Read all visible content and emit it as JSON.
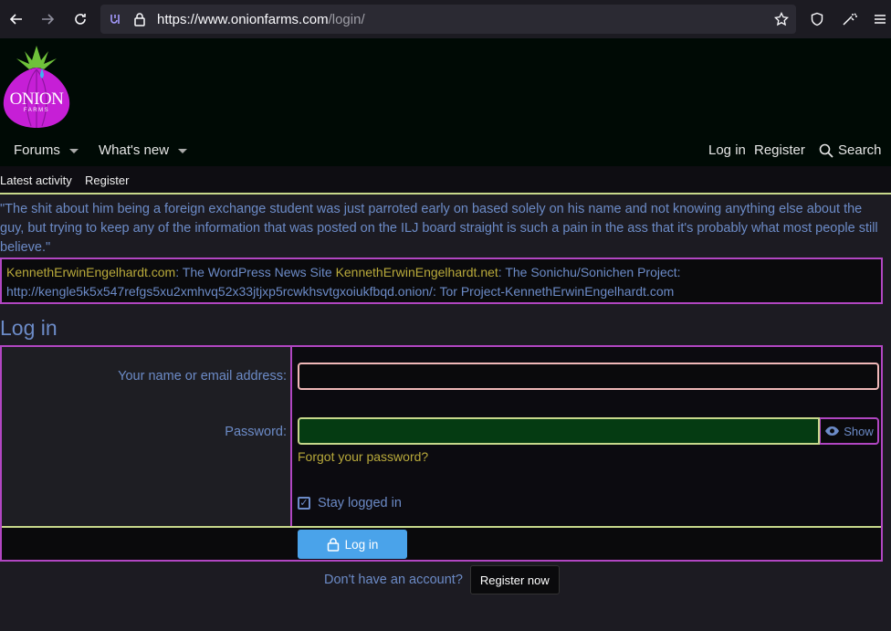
{
  "browser": {
    "url_main": "https://www.onionfarms.com",
    "url_path": "/login/"
  },
  "logo": {
    "line1": "ONION",
    "line2": "FARMS"
  },
  "nav": {
    "forums": "Forums",
    "whats_new": "What's new",
    "login": "Log in",
    "register": "Register",
    "search": "Search"
  },
  "subnav": {
    "latest": "Latest activity",
    "register": "Register"
  },
  "quote": "\"The shit about him being a foreign exchange student was just parroted early on based solely on his name and not knowing anything else about the guy, but trying to keep any of the information that was posted on the ILJ board straight is such a pain in the ass that it's probably what most people still believe.\"",
  "notice": {
    "site1": "KennethErwinEngelhardt.com",
    "desc1": ": The WordPress News Site ",
    "site2": "KennethErwinEngelhardt.net",
    "desc2": ": The Sonichu/Sonichen Project:",
    "onion": "http://kengle5k5x547refgs5xu2xmhvq52x33jtjxp5rcwkhsvtgxoiukfbqd.onion/",
    "desc3": ": Tor Project-KennethErwinEngelhardt.com"
  },
  "page_title": "Log in",
  "form": {
    "name_label": "Your name or email address:",
    "password_label": "Password:",
    "show_label": "Show",
    "forgot": "Forgot your password?",
    "stay": "Stay logged in",
    "login_button": "Log in"
  },
  "register": {
    "prompt": "Don't have an account?",
    "button": "Register now"
  },
  "colors": {
    "accent_purple": "#b146c2",
    "accent_green": "#c7d88b",
    "link_blue": "#6c8bc7",
    "link_gold": "#b9aa3b",
    "button_blue": "#4aa3ea"
  }
}
